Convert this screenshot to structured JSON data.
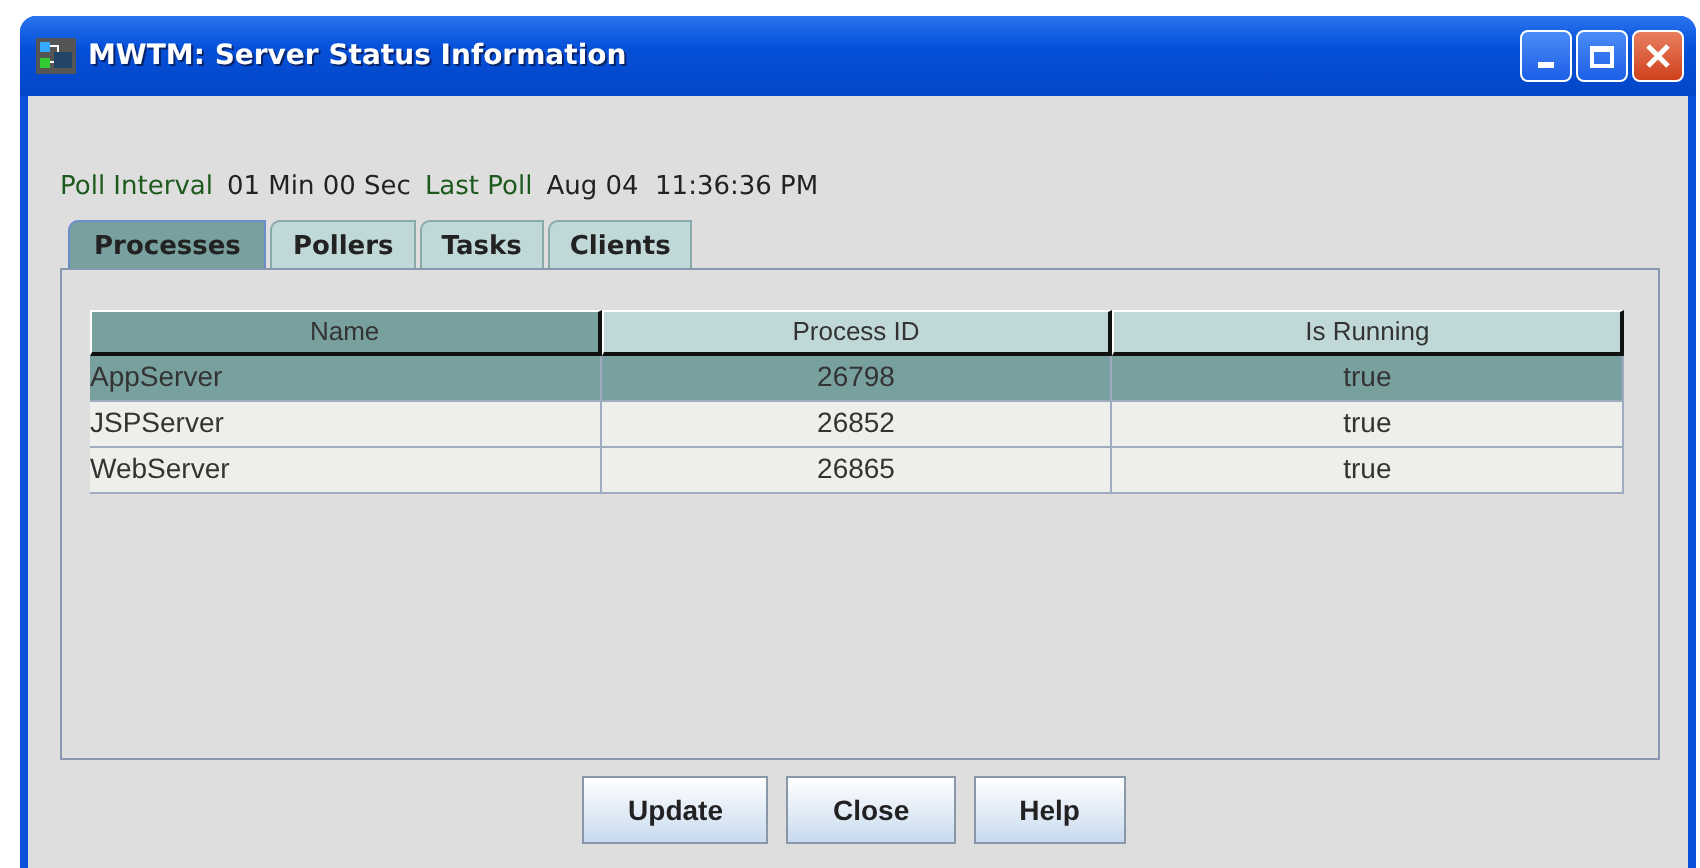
{
  "window": {
    "title": "MWTM: Server Status Information"
  },
  "poll": {
    "interval_label": "Poll Interval",
    "interval": "01 Min 00 Sec",
    "last_label": "Last Poll",
    "last": "Aug 04  11:36:36 PM"
  },
  "tabs": [
    {
      "label": "Processes",
      "selected": true
    },
    {
      "label": "Pollers",
      "selected": false
    },
    {
      "label": "Tasks",
      "selected": false
    },
    {
      "label": "Clients",
      "selected": false
    }
  ],
  "table": {
    "columns": [
      {
        "label": "Name",
        "selected": true
      },
      {
        "label": "Process ID",
        "selected": false
      },
      {
        "label": "Is Running",
        "selected": false
      }
    ],
    "rows": [
      {
        "cells": [
          "AppServer",
          "26798",
          "true"
        ],
        "selected": true
      },
      {
        "cells": [
          "JSPServer",
          "26852",
          "true"
        ],
        "selected": false
      },
      {
        "cells": [
          "WebServer",
          "26865",
          "true"
        ],
        "selected": false
      }
    ]
  },
  "buttons": [
    "Update",
    "Close",
    "Help"
  ]
}
